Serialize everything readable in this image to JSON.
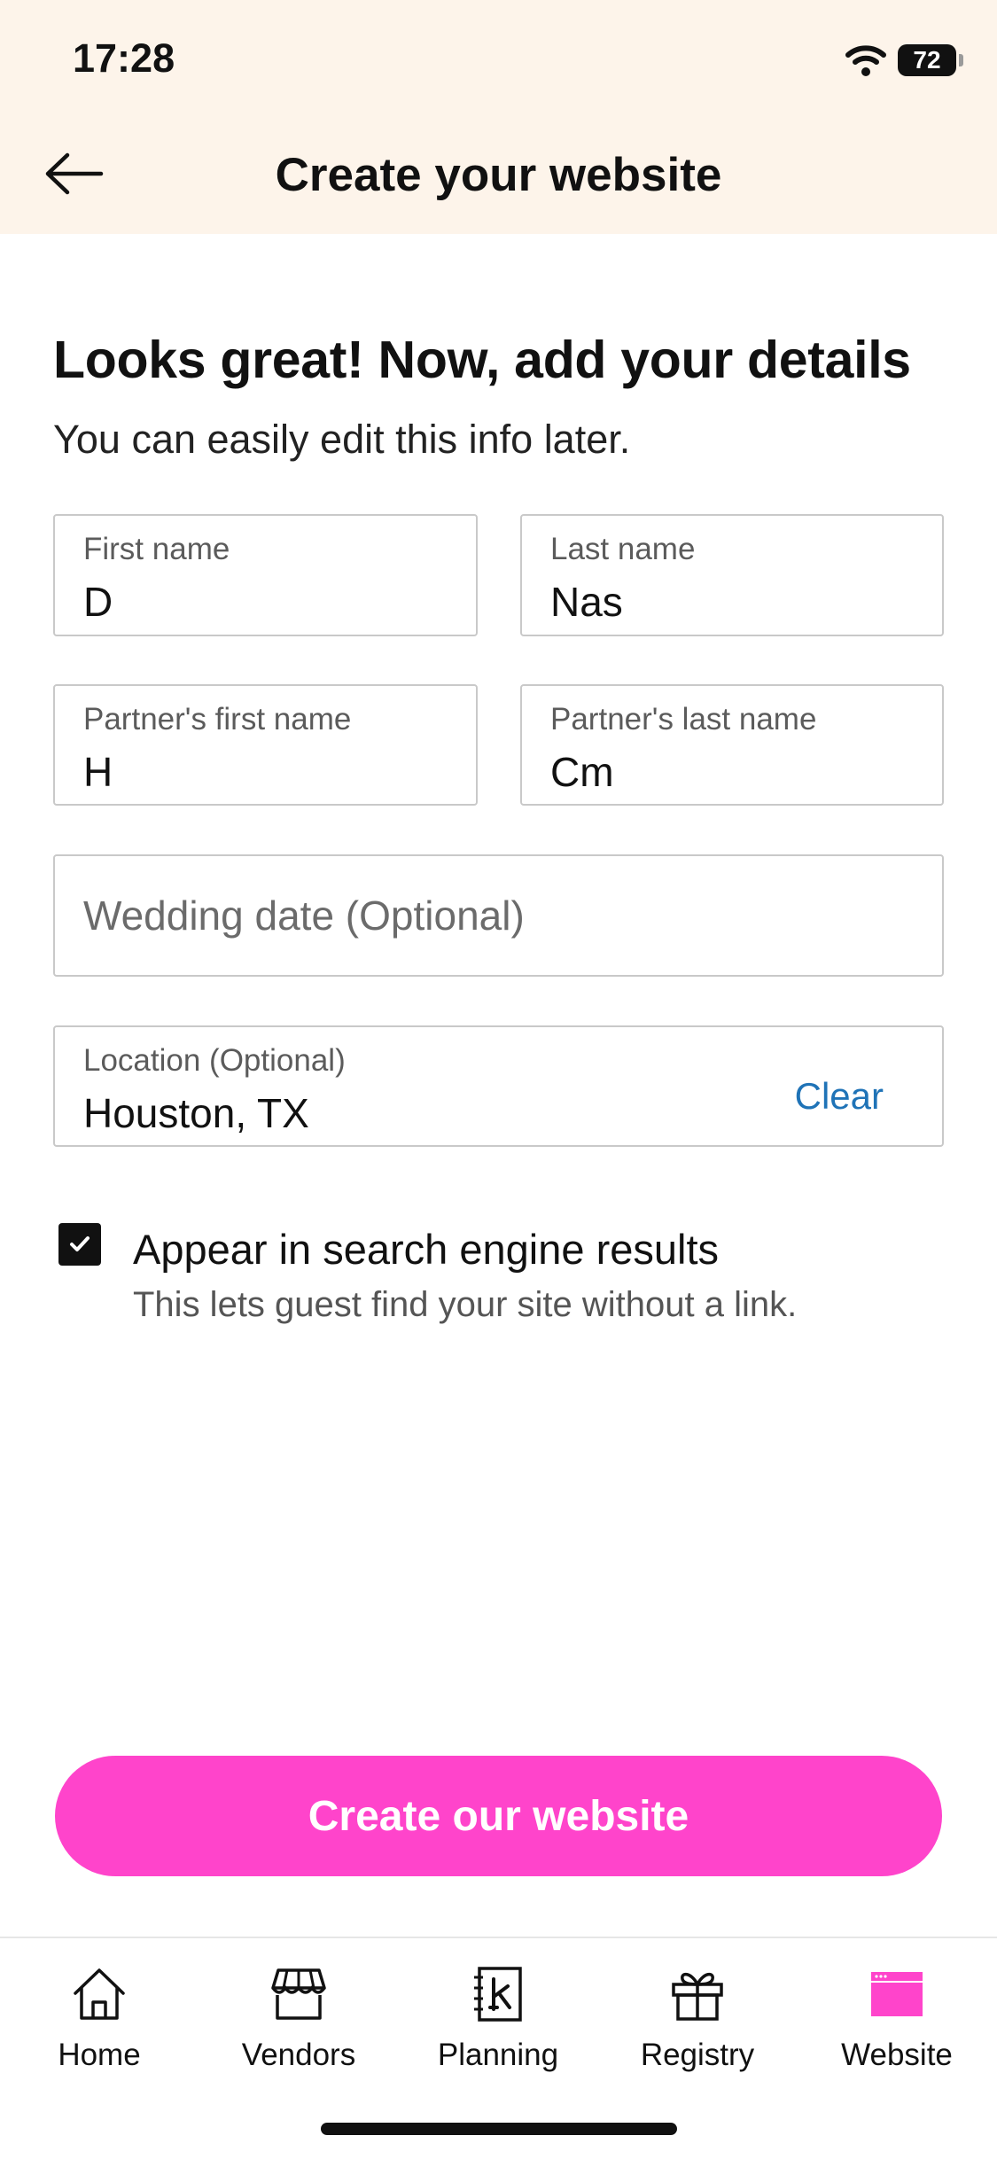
{
  "status_bar": {
    "time": "17:28",
    "battery": "72"
  },
  "header": {
    "title": "Create your website"
  },
  "main": {
    "heading": "Looks great! Now, add your details",
    "subheading": "You can easily edit this info later.",
    "fields": {
      "first_name": {
        "label": "First name",
        "value": "D"
      },
      "last_name": {
        "label": "Last name",
        "value": "Nas"
      },
      "partner_first_name": {
        "label": "Partner's first name",
        "value": "H"
      },
      "partner_last_name": {
        "label": "Partner's last name",
        "value": "Cm"
      },
      "wedding_date": {
        "placeholder": "Wedding date (Optional)"
      },
      "location": {
        "label": "Location (Optional)",
        "value": "Houston, TX",
        "clear_label": "Clear"
      }
    },
    "search_engine": {
      "checked": true,
      "title": "Appear in search engine results",
      "subtitle": "This lets guest find your site without a link."
    },
    "cta_label": "Create our website"
  },
  "tabbar": {
    "items": [
      {
        "label": "Home",
        "icon": "home-icon"
      },
      {
        "label": "Vendors",
        "icon": "storefront-icon"
      },
      {
        "label": "Planning",
        "icon": "planning-book-icon"
      },
      {
        "label": "Registry",
        "icon": "gift-icon"
      },
      {
        "label": "Website",
        "icon": "browser-window-icon",
        "active": true
      }
    ]
  },
  "colors": {
    "accent": "#ff44cb",
    "link": "#1f73b7",
    "header_bg": "#fdf4ea"
  }
}
